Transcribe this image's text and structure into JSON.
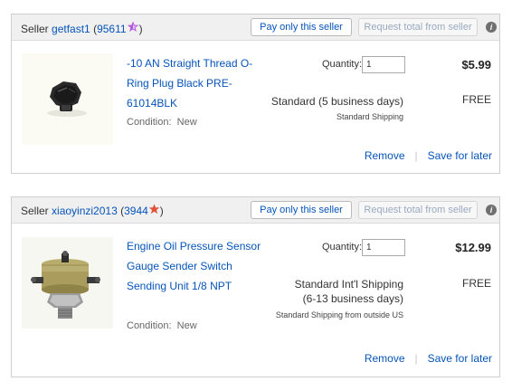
{
  "orders": [
    {
      "seller_label": "Seller",
      "seller_name": "getfast1",
      "feedback_open": "(",
      "feedback_score": "95611",
      "feedback_close": ")",
      "star_color": "#b45bd9",
      "pay_button": "Pay only this seller",
      "request_button": "Request total from seller",
      "info_icon": "i",
      "item": {
        "title": "-10 AN Straight Thread O-Ring Plug Black PRE-61014BLK",
        "condition_label": "Condition:",
        "condition_value": "New",
        "quantity_label": "Quantity:",
        "quantity_value": "1",
        "price": "$5.99",
        "shipping_cost": "FREE",
        "shipping_service": "Standard (5 business days)",
        "shipping_type": "Standard Shipping"
      },
      "remove_label": "Remove",
      "save_label": "Save for later",
      "separator": "|"
    },
    {
      "seller_label": "Seller",
      "seller_name": "xiaoyinzi2013",
      "feedback_open": "(",
      "feedback_score": "3944",
      "feedback_close": ")",
      "star_color": "#e0533a",
      "pay_button": "Pay only this seller",
      "request_button": "Request total from seller",
      "info_icon": "i",
      "item": {
        "title": "Engine Oil Pressure Sensor Gauge Sender Switch Sending Unit 1/8 NPT",
        "condition_label": "Condition:",
        "condition_value": "New",
        "quantity_label": "Quantity:",
        "quantity_value": "1",
        "price": "$12.99",
        "shipping_cost": "FREE",
        "shipping_service_line1": "Standard Int'l Shipping",
        "shipping_service_line2": "(6-13 business days)",
        "shipping_type": "Standard Shipping from outside US"
      },
      "remove_label": "Remove",
      "save_label": "Save for later",
      "separator": "|"
    }
  ],
  "icons": {
    "feedback_star": "star-icon",
    "info": "info-icon",
    "product1": "o-ring-plug-image",
    "product2": "pressure-sensor-image"
  }
}
